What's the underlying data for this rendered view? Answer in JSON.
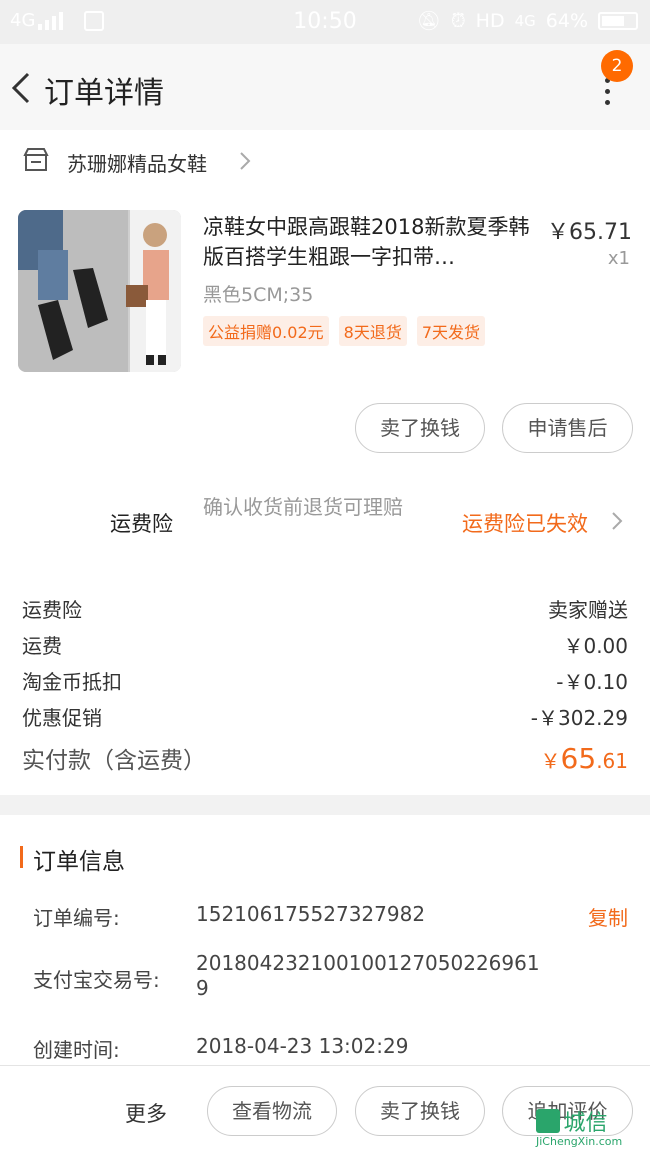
{
  "status_bar": {
    "network": "4G",
    "time": "10:50",
    "hd_label": "HD",
    "net_right": "4G",
    "battery": "64%"
  },
  "header": {
    "title": "订单详情",
    "badge_count": "2"
  },
  "shop": {
    "name": "苏珊娜精品女鞋"
  },
  "product": {
    "title": "凉鞋女中跟高跟鞋2018新款夏季韩版百搭学生粗跟一字扣带…",
    "price": "￥65.71",
    "quantity": "x1",
    "sku": "黑色5CM;35",
    "tags": [
      "公益捐赠0.02元",
      "8天退货",
      "7天发货"
    ],
    "buttons": {
      "sell": "卖了换钱",
      "after_sale": "申请售后"
    }
  },
  "insurance": {
    "label": "运费险",
    "description": "确认收货前退货可理赔",
    "status": "运费险已失效"
  },
  "fees": [
    {
      "label": "运费险",
      "value": "卖家赠送"
    },
    {
      "label": "运费",
      "value": "￥0.00"
    },
    {
      "label": "淘金币抵扣",
      "value": "-￥0.10"
    },
    {
      "label": "优惠促销",
      "value": "-￥302.29"
    }
  ],
  "total": {
    "label": "实付款（含运费）",
    "currency": "￥",
    "integer": "65",
    "decimal": ".61"
  },
  "order_info": {
    "title": "订单信息",
    "order_no_label": "订单编号:",
    "order_no": "152106175527327982",
    "copy_label": "复制",
    "alipay_label": "支付宝交易号:",
    "alipay_no": "2018042321001001270502269619",
    "created_label": "创建时间:",
    "created_at": "2018-04-23 13:02:29"
  },
  "bottom_bar": {
    "more": "更多",
    "logistics": "查看物流",
    "sell": "卖了换钱",
    "review": "追加评价"
  },
  "watermark": {
    "text": "城信",
    "sub": "JiChengXin.com"
  },
  "colors": {
    "accent": "#f26a1b",
    "badge": "#ff6a00",
    "watermark": "#2aa56b"
  }
}
